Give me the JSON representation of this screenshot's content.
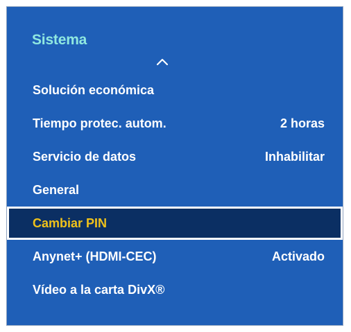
{
  "panel": {
    "title": "Sistema",
    "scroll_icon": "chevron-up-icon",
    "colors": {
      "background": "#1f5fb7",
      "title": "#8fe8e0",
      "text": "#ffffff",
      "selected_background": "#0b2f63",
      "selected_text": "#f0c21a",
      "selected_border": "#ffffff"
    }
  },
  "menu": {
    "items": [
      {
        "label": "Solución económica",
        "value": ""
      },
      {
        "label": "Tiempo protec. autom.",
        "value": "2 horas"
      },
      {
        "label": "Servicio de datos",
        "value": "Inhabilitar"
      },
      {
        "label": "General",
        "value": ""
      },
      {
        "label": "Cambiar PIN",
        "value": "",
        "selected": true
      },
      {
        "label": "Anynet+ (HDMI-CEC)",
        "value": "Activado"
      },
      {
        "label": "Vídeo a la carta DivX®",
        "value": ""
      }
    ]
  }
}
